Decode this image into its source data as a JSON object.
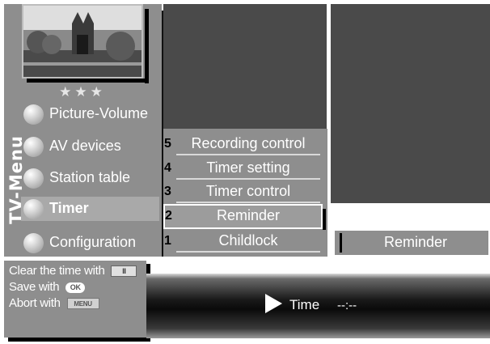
{
  "menu": {
    "title": "TV-Menu",
    "stars": "★★★",
    "items": [
      {
        "label": "Picture-Volume"
      },
      {
        "label": "AV devices"
      },
      {
        "label": "Station table"
      },
      {
        "label": "Timer"
      },
      {
        "label": "Configuration"
      }
    ]
  },
  "submenu": {
    "items": [
      {
        "num": "5",
        "label": "Recording control"
      },
      {
        "num": "4",
        "label": "Timer setting"
      },
      {
        "num": "3",
        "label": "Timer control"
      },
      {
        "num": "2",
        "label": "Reminder"
      },
      {
        "num": "1",
        "label": "Childlock"
      }
    ]
  },
  "right_panel": {
    "indicator": "I",
    "label": "Reminder"
  },
  "help": {
    "clear": "Clear the time with",
    "clear_icon": "II",
    "save": "Save with",
    "save_icon": "OK",
    "abort": "Abort with",
    "abort_icon": "MENU"
  },
  "timebar": {
    "label": "Time",
    "value": "--:--"
  }
}
